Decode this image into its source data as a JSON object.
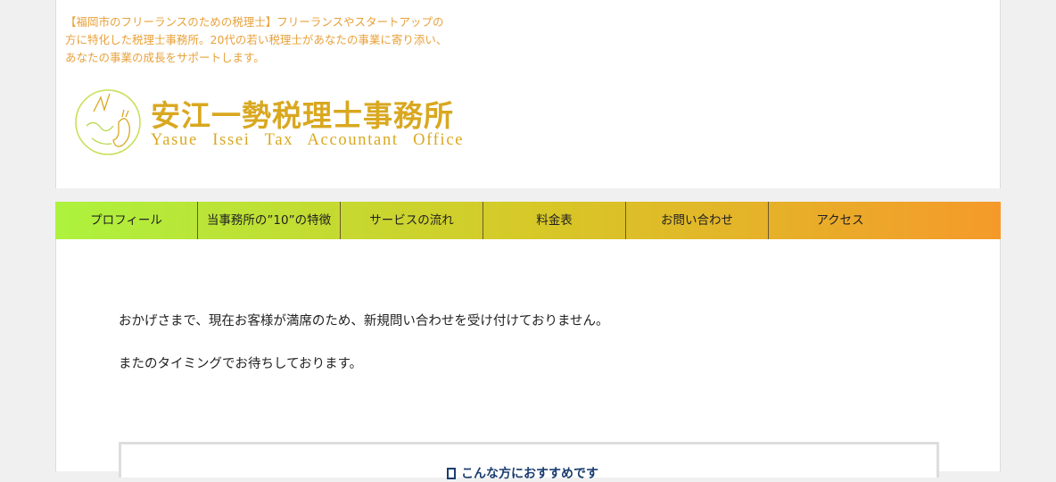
{
  "header": {
    "tagline": "【福岡市のフリーランスのための税理士】フリーランスやスタートアップの\n方に特化した税理士事務所。20代の若い税理士があなたの事業に寄り添い、\nあなたの事業の成長をサポートします。",
    "logo": {
      "name_jp": "安江一勢税理士事務所",
      "name_en": "Yasue Issei Tax Accountant Office"
    }
  },
  "nav": {
    "items": [
      {
        "label": "プロフィール"
      },
      {
        "label": "当事務所の”10”の特徴"
      },
      {
        "label": "サービスの流れ"
      },
      {
        "label": "料金表"
      },
      {
        "label": "お問い合わせ"
      },
      {
        "label": "アクセス"
      }
    ]
  },
  "main": {
    "message1": "おかげさまで、現在お客様が満席のため、新規問い合わせを受け付けておりません。",
    "message2": "またのタイミングでお待ちしております。",
    "box_title": "こんな方におすすめです"
  },
  "colors": {
    "accent": "#e8a13a",
    "logo": "#d9a820",
    "nav_start": "#adf23e",
    "nav_end": "#f59a2a"
  }
}
